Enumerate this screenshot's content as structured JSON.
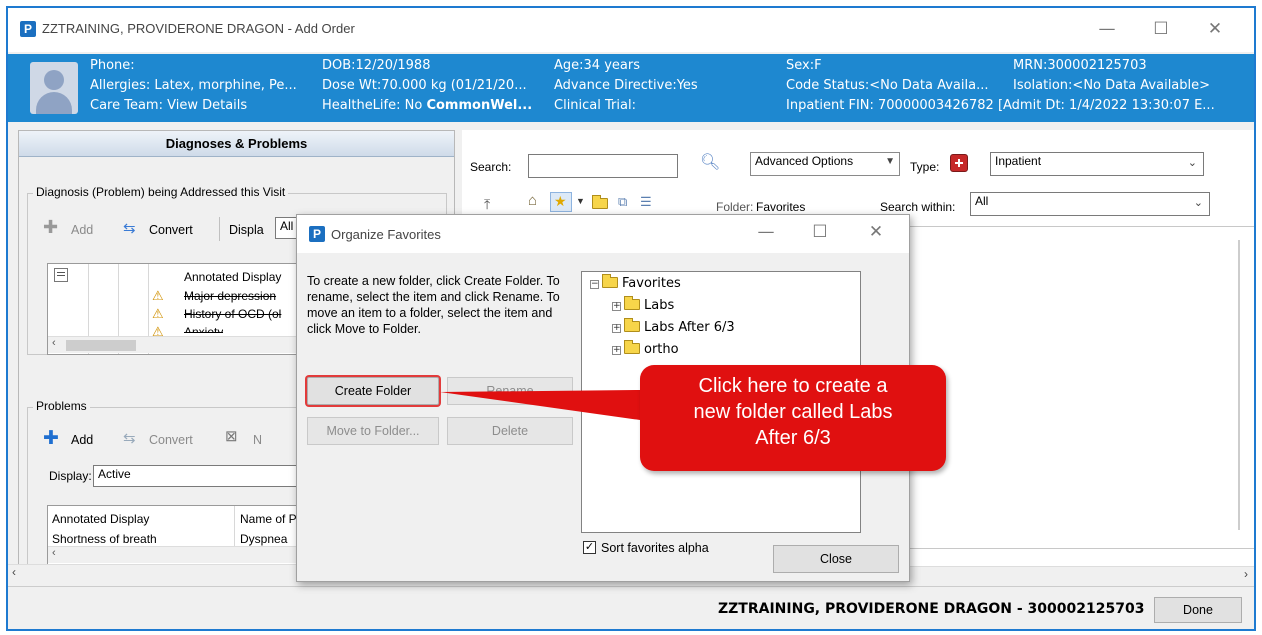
{
  "window": {
    "title": "ZZTRAINING, PROVIDERONE DRAGON - Add Order",
    "app_badge": "P",
    "controls": {
      "minimize": "—",
      "maximize": "☐",
      "close": "✕"
    }
  },
  "banner": {
    "phone": "Phone:",
    "allergies": "Allergies: Latex, morphine, Pe...",
    "care_team": "Care Team: View Details",
    "dob": "DOB:12/20/1988",
    "dose_wt": "Dose Wt:70.000 kg (01/21/20...",
    "healthelife_prefix": "HealtheLife: No ",
    "healthelife_bold": "CommonWel...",
    "age": "Age:34 years",
    "advance_directive": "Advance Directive:Yes",
    "clinical_trial": "Clinical Trial:",
    "sex": "Sex:F",
    "code_status": "Code Status:<No Data Availa...",
    "mrn": "MRN:300002125703",
    "isolation": "Isolation:<No Data Available>",
    "inpatient_fin": "Inpatient FIN: 70000003426782 [Admit Dt: 1/4/2022 13:30:07 E..."
  },
  "left": {
    "header": "Diagnoses & Problems",
    "diagnosis_group": "Diagnosis (Problem) being Addressed this Visit",
    "dx_toolbar": {
      "add": "Add",
      "convert": "Convert",
      "display": "Displa",
      "display_value": "All"
    },
    "dx_grid": {
      "header": "Annotated Display",
      "rows": [
        "Major depression",
        "History of OCD (ol",
        "Anxiety"
      ]
    },
    "problems_group": "Problems",
    "prob_toolbar": {
      "add": "Add",
      "convert": "Convert",
      "next": "N"
    },
    "display_label": "Display:",
    "display_value": "Active",
    "prob_grid": {
      "col1": "Annotated Display",
      "col2": "Name of P",
      "row1_col1": "Shortness of breath",
      "row1_col2": "Dyspnea"
    }
  },
  "right": {
    "search_label": "Search:",
    "search_value": "",
    "advanced_options": "Advanced Options",
    "type_label": "Type:",
    "type_value": "Inpatient",
    "folder_label": "Folder:",
    "folder_value": "Favorites",
    "search_within_label": "Search within:",
    "search_within_value": "All"
  },
  "dialog": {
    "title": "Organize Favorites",
    "instructions": "To create a new folder, click Create Folder. To rename, select the item and click Rename. To move an item to a folder, select the item and click Move to Folder.",
    "buttons": {
      "create_folder": "Create Folder",
      "rename": "Rename",
      "move_to_folder": "Move to Folder...",
      "delete": "Delete",
      "close": "Close"
    },
    "tree": {
      "root": "Favorites",
      "children": [
        "Labs",
        "Labs After 6/3",
        "ortho"
      ]
    },
    "sort_checkbox": {
      "label": "Sort favorites alpha",
      "checked": true
    }
  },
  "callout": {
    "text": "Click here to create a new folder called Labs After 6/3",
    "line1": "Click here to create a",
    "line2": "new folder called Labs",
    "line3": "After 6/3",
    "color": "#e01010"
  },
  "bottom": {
    "patient_id": "ZZTRAINING, PROVIDERONE DRAGON - 300002125703",
    "done": "Done"
  },
  "colors": {
    "banner": "#1e88d0",
    "window_border": "#1e7ad0",
    "callout": "#e01010"
  }
}
